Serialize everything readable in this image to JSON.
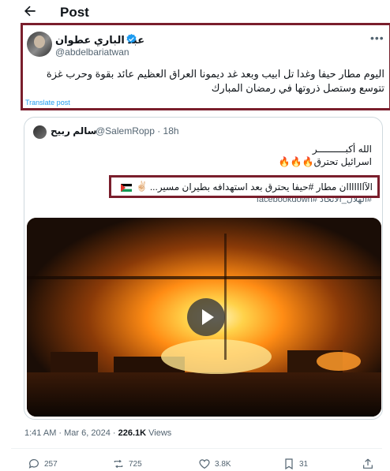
{
  "header": {
    "title": "Post"
  },
  "post": {
    "author_name": "عبد الباري عطوان",
    "handle": "@abdelbariatwan",
    "text_line1": "اليوم مطار حيفا وغدا تل ابيب وبعد غد ديمونا العراق العظيم عائد بقوة وحرب غزة",
    "text_line2": "تتوسع وستصل ذروتها في رمضان المبارك",
    "translate_label": "Translate post"
  },
  "quote": {
    "author_name": "سالم ربيح",
    "handle_time": "@SalemRopp · 18h",
    "line1": "الله أكبــــــــــر",
    "line2": "اسرائيل تحترق🔥🔥🔥",
    "highlight_text": "الآااااااان مطار #حيفا يحترق بعد استهدافه بطيران مسير...",
    "peace_emoji": "✌🏻",
    "hashtag_line": "#الهلال_الاتحاد #facebookdown"
  },
  "meta": {
    "time": "1:41 AM · Mar 6, 2024 · ",
    "views_count": "226.1K",
    "views_label": " Views"
  },
  "actions": {
    "replies": "257",
    "reposts": "725",
    "likes": "3.8K",
    "bookmarks": "31"
  },
  "colors": {
    "highlight_border": "#7a1e2c",
    "link_blue": "#1d9bf0",
    "muted_text": "#536471",
    "primary_text": "#0f1419"
  }
}
